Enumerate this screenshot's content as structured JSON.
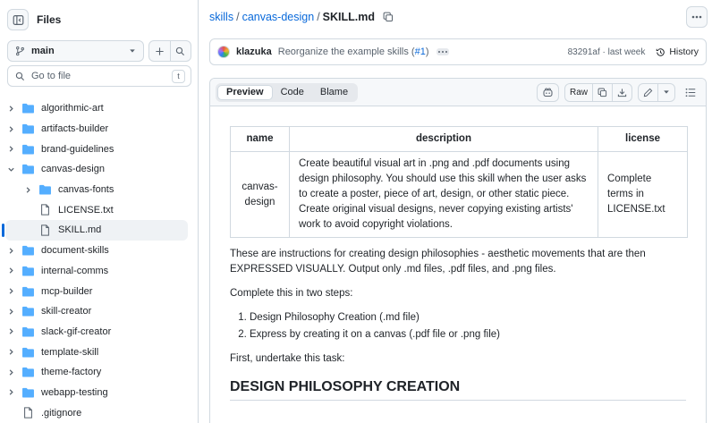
{
  "sidebar": {
    "title": "Files",
    "branch": "main",
    "goto_placeholder": "Go to file",
    "goto_shortcut": "t",
    "tree": [
      {
        "label": "algorithmic-art",
        "type": "folder",
        "depth": 0,
        "expanded": false
      },
      {
        "label": "artifacts-builder",
        "type": "folder",
        "depth": 0,
        "expanded": false
      },
      {
        "label": "brand-guidelines",
        "type": "folder",
        "depth": 0,
        "expanded": false
      },
      {
        "label": "canvas-design",
        "type": "folder",
        "depth": 0,
        "expanded": true
      },
      {
        "label": "canvas-fonts",
        "type": "folder",
        "depth": 1,
        "expanded": false
      },
      {
        "label": "LICENSE.txt",
        "type": "file",
        "depth": 1
      },
      {
        "label": "SKILL.md",
        "type": "file",
        "depth": 1,
        "selected": true
      },
      {
        "label": "document-skills",
        "type": "folder",
        "depth": 0,
        "expanded": false
      },
      {
        "label": "internal-comms",
        "type": "folder",
        "depth": 0,
        "expanded": false
      },
      {
        "label": "mcp-builder",
        "type": "folder",
        "depth": 0,
        "expanded": false
      },
      {
        "label": "skill-creator",
        "type": "folder",
        "depth": 0,
        "expanded": false
      },
      {
        "label": "slack-gif-creator",
        "type": "folder",
        "depth": 0,
        "expanded": false
      },
      {
        "label": "template-skill",
        "type": "folder",
        "depth": 0,
        "expanded": false
      },
      {
        "label": "theme-factory",
        "type": "folder",
        "depth": 0,
        "expanded": false
      },
      {
        "label": "webapp-testing",
        "type": "folder",
        "depth": 0,
        "expanded": false
      },
      {
        "label": ".gitignore",
        "type": "file",
        "depth": 0
      }
    ]
  },
  "breadcrumb": {
    "repo": "skills",
    "folder": "canvas-design",
    "file": "SKILL.md",
    "sep": "/"
  },
  "commit": {
    "author": "klazuka",
    "message": "Reorganize the example skills (",
    "pr": "#1",
    "message_end": ")",
    "sha_time": "83291af · last week",
    "history": "History"
  },
  "file_header": {
    "tabs": [
      "Preview",
      "Code",
      "Blame"
    ],
    "active_tab": "Preview",
    "raw": "Raw"
  },
  "doc": {
    "table": {
      "headers": [
        "name",
        "description",
        "license"
      ],
      "row": {
        "name": "canvas-design",
        "description": "Create beautiful visual art in .png and .pdf documents using design philosophy. You should use this skill when the user asks to create a poster, piece of art, design, or other static piece. Create original visual designs, never copying existing artists' work to avoid copyright violations.",
        "license": "Complete terms in LICENSE.txt"
      }
    },
    "p1": "These are instructions for creating design philosophies - aesthetic movements that are then EXPRESSED VISUALLY. Output only .md files, .pdf files, and .png files.",
    "p2": "Complete this in two steps:",
    "steps": [
      "Design Philosophy Creation (.md file)",
      "Express by creating it on a canvas (.pdf file or .png file)"
    ],
    "p3": "First, undertake this task:",
    "h2": "DESIGN PHILOSOPHY CREATION"
  },
  "colors": {
    "accent": "#0969da",
    "folder": "#54aeff",
    "border": "#d1d9e0"
  }
}
